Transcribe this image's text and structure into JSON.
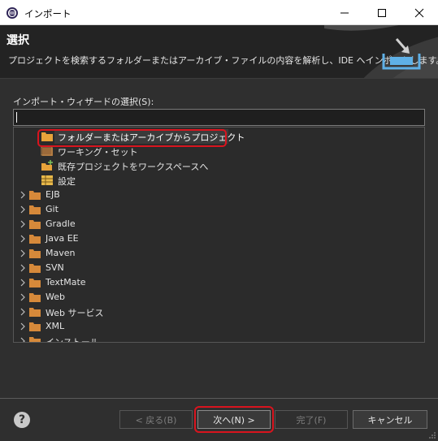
{
  "window": {
    "title": "インポート",
    "minimize_icon": "minimize-icon",
    "maximize_icon": "maximize-icon",
    "close_icon": "close-icon"
  },
  "banner": {
    "heading": "選択",
    "description": "プロジェクトを検索するフォルダーまたはアーカイブ・ファイルの内容を解析し、IDE へインポートします。"
  },
  "wizard": {
    "select_label": "インポート・ウィザードの選択(S):",
    "filter_value": "",
    "tree": {
      "children": [
        {
          "label": "フォルダーまたはアーカイブからプロジェクト",
          "icon": "folder-icon",
          "selected": true
        },
        {
          "label": "ワーキング・セット",
          "icon": "working-set-icon"
        },
        {
          "label": "既存プロジェクトをワークスペースへ",
          "icon": "existing-project-icon"
        },
        {
          "label": "設定",
          "icon": "preferences-icon"
        }
      ],
      "categories": [
        {
          "label": "EJB"
        },
        {
          "label": "Git"
        },
        {
          "label": "Gradle"
        },
        {
          "label": "Java EE"
        },
        {
          "label": "Maven"
        },
        {
          "label": "SVN"
        },
        {
          "label": "TextMate"
        },
        {
          "label": "Web"
        },
        {
          "label": "Web サービス"
        },
        {
          "label": "XML"
        },
        {
          "label": "インストール"
        }
      ]
    }
  },
  "footer": {
    "help_label": "?",
    "back_label": "< 戻る(B)",
    "next_label": "次へ(N) >",
    "finish_label": "完了(F)",
    "cancel_label": "キャンセル"
  },
  "colors": {
    "highlight": "#d9141e",
    "folder": "#e8a33a",
    "background": "#2f2f2f"
  }
}
